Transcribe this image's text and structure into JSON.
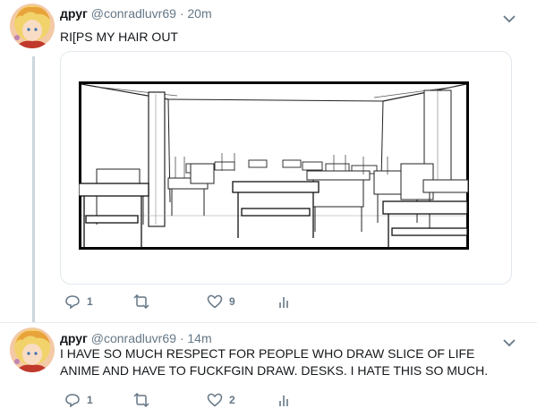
{
  "tweets": [
    {
      "author": {
        "name": "друг",
        "handle": "@conradluvr69"
      },
      "time": "20m",
      "text": "RI[PS MY HAIR OUT",
      "stats": {
        "replies": "1",
        "retweets": "",
        "likes": "9"
      },
      "has_media": true
    },
    {
      "author": {
        "name": "друг",
        "handle": "@conradluvr69"
      },
      "time": "14m",
      "text": "I HAVE SO MUCH RESPECT FOR PEOPLE WHO DRAW SLICE OF LIFE ANIME AND HAVE TO FUCKFGIN DRAW. DESKS. I HATE THIS SO MUCH.",
      "stats": {
        "replies": "1",
        "retweets": "",
        "likes": "2"
      },
      "has_media": false
    }
  ],
  "separator": "·",
  "colors": {
    "text": "#14171a",
    "muted": "#657786",
    "border": "#e1e8ed",
    "thread": "#ccd6dd"
  }
}
